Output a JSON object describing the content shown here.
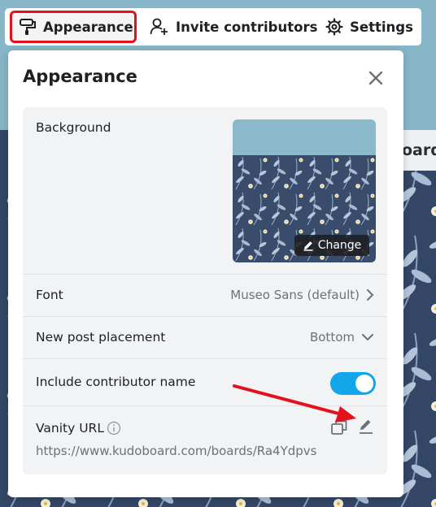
{
  "toolbar": {
    "appearance_label": "Appearance",
    "invite_label": "Invite contributors",
    "settings_label": "Settings",
    "highlight_color": "#e3111b"
  },
  "background_page": {
    "partial_button_text": "oard"
  },
  "modal": {
    "title": "Appearance",
    "close_icon": "close-icon",
    "rows": {
      "background": {
        "label": "Background",
        "change_label": "Change"
      },
      "font": {
        "label": "Font",
        "value": "Museo Sans (default)"
      },
      "placement": {
        "label": "New post placement",
        "value": "Bottom"
      },
      "contributor": {
        "label": "Include contributor name",
        "enabled": true
      },
      "vanity": {
        "label": "Vanity URL",
        "url": "https://www.kudoboard.com/boards/Ra4Ydpvs"
      }
    }
  },
  "colors": {
    "toggle_on": "#13a6ea",
    "annotation_arrow": "#e3111b",
    "pattern_bg": "#344666",
    "sky": "#86b6c7"
  }
}
